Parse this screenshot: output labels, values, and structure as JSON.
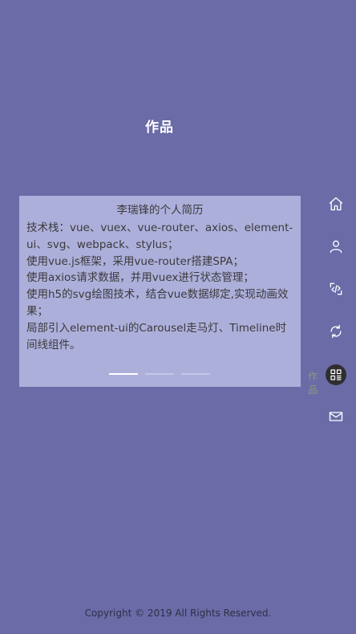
{
  "header": {
    "title": "作品"
  },
  "card": {
    "title": "李瑞锋的个人简历",
    "lines": [
      "技术栈：vue、vuex、vue-router、axios、element-ui、svg、webpack、stylus；",
      "使用vue.js框架，采用vue-router搭建SPA；",
      "使用axios请求数据，并用vuex进行状态管理；",
      "使用h5的svg绘图技术，结合vue数据绑定,实现动画效果；",
      "局部引入element-ui的Carousel走马灯、Timeline时间线组件。"
    ]
  },
  "carousel": {
    "count": 3,
    "active": 0
  },
  "side_nav": {
    "active_label": "作品",
    "items": [
      {
        "icon": "home-icon"
      },
      {
        "icon": "user-icon"
      },
      {
        "icon": "code-icon"
      },
      {
        "icon": "refresh-icon"
      },
      {
        "icon": "grid-icon"
      },
      {
        "icon": "mail-icon"
      }
    ]
  },
  "footer": {
    "copyright": "Copyright © 2019 All Rights Reserved."
  },
  "colors": {
    "background": "#6b6ba8",
    "card": "#adafdb",
    "active_nav": "#2e2e2e"
  }
}
